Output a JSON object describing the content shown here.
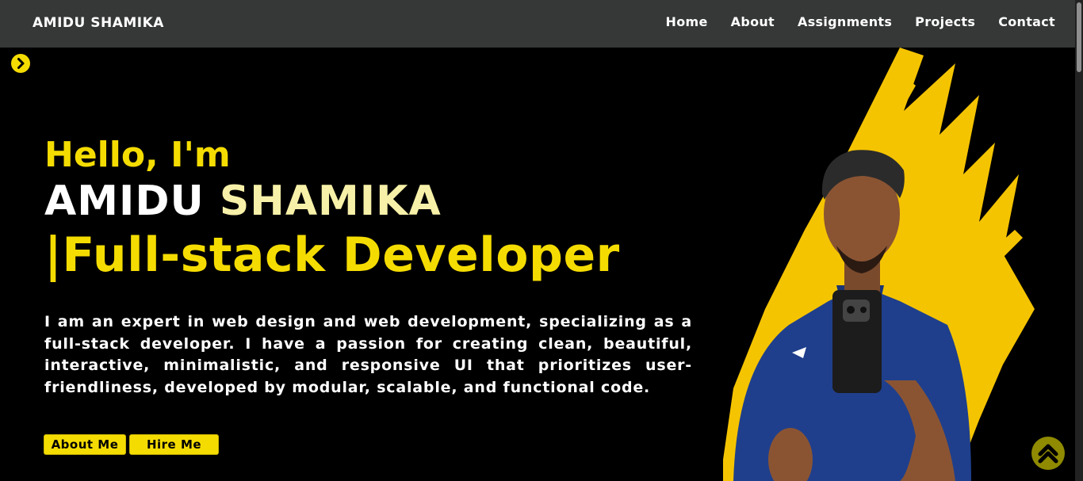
{
  "brand": "AMIDU SHAMIKA",
  "nav": {
    "items": [
      "Home",
      "About",
      "Assignments",
      "Projects",
      "Contact"
    ]
  },
  "hero": {
    "greeting": "Hello, I'm",
    "name_first": "AMIDU",
    "name_last": "SHAMIKA",
    "role": "|Full-stack Developer",
    "bio": "I am an expert in web design and web development, specializing as a full-stack developer. I have a passion for creating clean, beautiful, interactive, minimalistic, and responsive UI that prioritizes user-friendliness, developed by modular, scalable, and functional code.",
    "buttons": {
      "about": "About Me",
      "hire": "Hire Me"
    }
  },
  "icons": {
    "side_toggle": "chevron-right-icon",
    "back_to_top": "double-chevron-up-icon"
  },
  "colors": {
    "accent": "#f5dc00",
    "navbar": "#353836",
    "background": "#000000",
    "name_last": "#f7f0a8",
    "back_to_top": "#8f8a00"
  }
}
